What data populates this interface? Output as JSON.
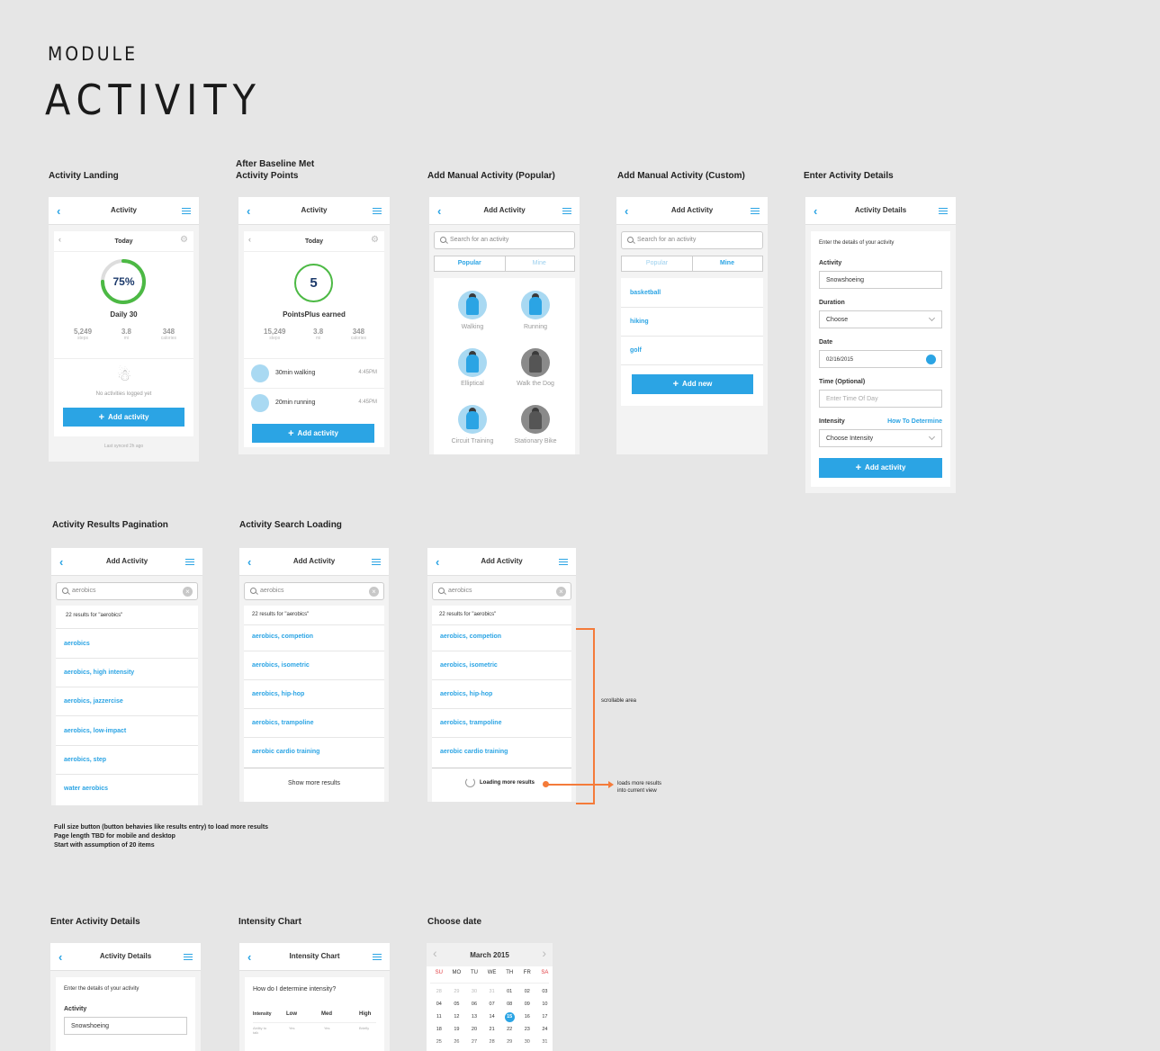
{
  "header": {
    "small": "MODULE",
    "big": "ACTIVITY"
  },
  "labels": {
    "landing": "Activity Landing",
    "after_baseline_1": "After Baseline Met",
    "after_baseline_2": "Activity Points",
    "add_popular": "Add Manual Activity (Popular)",
    "add_custom": "Add Manual Activity (Custom)",
    "enter_details": "Enter Activity Details",
    "results_pagination": "Activity Results Pagination",
    "search_loading": "Activity Search Loading",
    "enter_details_2": "Enter Activity Details",
    "intensity_chart": "Intensity Chart",
    "choose_date": "Choose date"
  },
  "common": {
    "activity_title": "Activity",
    "add_activity_title": "Add Activity",
    "details_title": "Activity Details",
    "intensity_title": "Intensity Chart",
    "today": "Today",
    "add_activity_btn": "Add activity",
    "add_new_btn": "Add new",
    "search_placeholder": "Search for an activity",
    "search_value": "aerobics",
    "tab_popular": "Popular",
    "tab_mine": "Mine"
  },
  "landing": {
    "percent": "75%",
    "progress": 0.75,
    "daily": "Daily 30",
    "stats": [
      {
        "value": "5,249",
        "unit": "steps"
      },
      {
        "value": "3.8",
        "unit": "mi"
      },
      {
        "value": "348",
        "unit": "calories"
      }
    ],
    "empty": "No activities logged yet",
    "synced": "Last synced 2h ago"
  },
  "baseline": {
    "points": "5",
    "earned": "PointsPlus earned",
    "stats": [
      {
        "value": "15,249",
        "unit": "steps"
      },
      {
        "value": "3.8",
        "unit": "mi"
      },
      {
        "value": "348",
        "unit": "calories"
      }
    ],
    "entries": [
      {
        "name": "30min walking",
        "time": "4:45PM"
      },
      {
        "name": "20min running",
        "time": "4:45PM"
      }
    ]
  },
  "popular": [
    {
      "name": "Walking"
    },
    {
      "name": "Running"
    },
    {
      "name": "Elliptical"
    },
    {
      "name": "Walk the Dog"
    },
    {
      "name": "Circuit Training"
    },
    {
      "name": "Stationary Bike"
    }
  ],
  "custom": [
    "basketball",
    "hiking",
    "golf"
  ],
  "details": {
    "intro": "Enter the details of your activity",
    "activity_label": "Activity",
    "activity_value": "Snowshoeing",
    "duration_label": "Duration",
    "duration_value": "Choose",
    "date_label": "Date",
    "date_value": "02/16/2015",
    "time_label": "Time (Optional)",
    "time_placeholder": "Enter Time Of Day",
    "intensity_label": "Intensity",
    "intensity_link": "How To Determine",
    "intensity_value": "Choose Intensity"
  },
  "results": {
    "count": "22 results for \"aerobics\"",
    "pagination": [
      "aerobics",
      "aerobics, high intensity",
      "aerobics, jazzercise",
      "aerobics, low-impact",
      "aerobics, step",
      "water aerobics"
    ],
    "loading": [
      "aerobics, competion",
      "aerobics, isometric",
      "aerobics, hip-hop",
      "aerobics, trampoline",
      "aerobic cardio training"
    ],
    "show_more": "Show more results",
    "loading_more": "Loading more results"
  },
  "annotations": {
    "scrollable": "scrollable area",
    "loads_1": "loads more results",
    "loads_2": "into current view",
    "note_1": "Full size button (button behavies like results entry) to load more results",
    "note_2": "Page length TBD for mobile and desktop",
    "note_3": "Start with assumption of 20 items"
  },
  "intensity": {
    "question": "How do I determine intensity?",
    "headers": [
      "Intensity",
      "Low",
      "Med",
      "High"
    ],
    "row": [
      "Ability to talk",
      "Yes",
      "Yes",
      "Briefly"
    ]
  },
  "calendar": {
    "month": "March 2015",
    "weekdays": [
      "SU",
      "MO",
      "TU",
      "WE",
      "TH",
      "FR",
      "SA"
    ],
    "weeks": [
      [
        "28",
        "29",
        "30",
        "31",
        "01",
        "02",
        "03"
      ],
      [
        "04",
        "05",
        "06",
        "07",
        "08",
        "09",
        "10"
      ],
      [
        "11",
        "12",
        "13",
        "14",
        "15",
        "16",
        "17"
      ],
      [
        "18",
        "19",
        "20",
        "21",
        "22",
        "23",
        "24"
      ],
      [
        "25",
        "26",
        "27",
        "28",
        "29",
        "30",
        "31"
      ]
    ],
    "selected": "15"
  },
  "colors": {
    "accent": "#2ba4e4",
    "progress": "#4cb944",
    "annotation": "#f47b3a"
  }
}
